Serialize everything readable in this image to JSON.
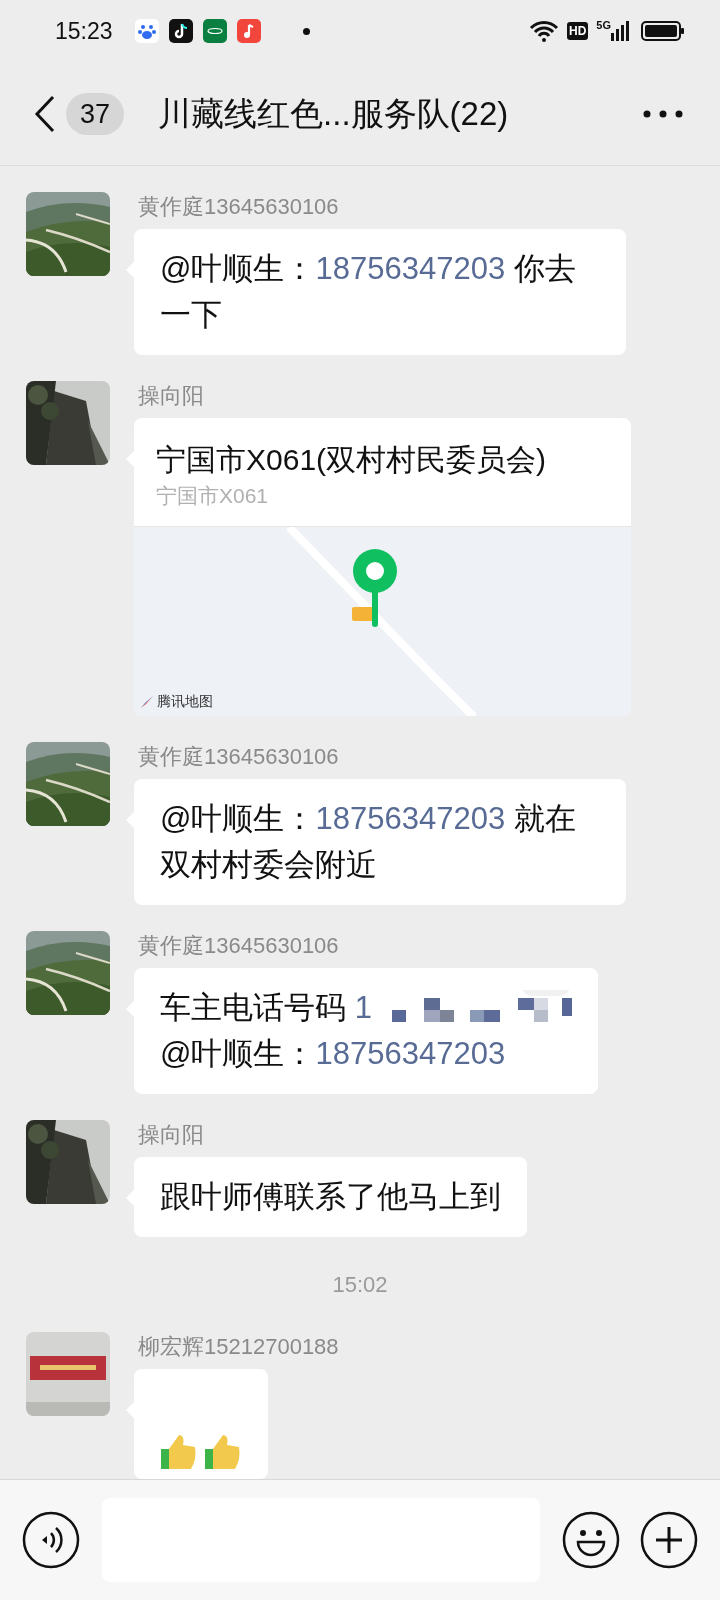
{
  "status_bar": {
    "time": "15:23",
    "hd": "HD",
    "network": "5G"
  },
  "header": {
    "back_count": "37",
    "title": "川藏线红色...服务队(22)"
  },
  "messages": [
    {
      "kind": "text",
      "sender": "黄作庭13645630106",
      "lines": [
        [
          {
            "text": "@叶顺生：",
            "link": false
          },
          {
            "text": "18756347203",
            "link": true
          },
          {
            "text": " 你去一下",
            "link": false
          }
        ]
      ]
    },
    {
      "kind": "location",
      "sender": "操向阳",
      "place": "宁国市X061(双村村民委员会)",
      "address": "宁国市X061",
      "attribution": "腾讯地图"
    },
    {
      "kind": "text",
      "sender": "黄作庭13645630106",
      "lines": [
        [
          {
            "text": "@叶顺生：",
            "link": false
          },
          {
            "text": "18756347203",
            "link": true
          },
          {
            "text": " 就在双村村委会附近",
            "link": false
          }
        ]
      ]
    },
    {
      "kind": "text",
      "sender": "黄作庭13645630106",
      "lines": [
        [
          {
            "text": "车主电话号码 ",
            "link": false
          },
          {
            "text": "1",
            "link": true,
            "redacted": true
          }
        ],
        [
          {
            "text": "@叶顺生：",
            "link": false
          },
          {
            "text": "18756347203",
            "link": true
          }
        ]
      ]
    },
    {
      "kind": "text",
      "sender": "操向阳",
      "lines": [
        [
          {
            "text": "跟叶师傅联系了他马上到",
            "link": false
          }
        ]
      ]
    },
    {
      "kind": "time",
      "text": "15:02"
    },
    {
      "kind": "sticker",
      "sender": "柳宏辉15212700188"
    }
  ]
}
